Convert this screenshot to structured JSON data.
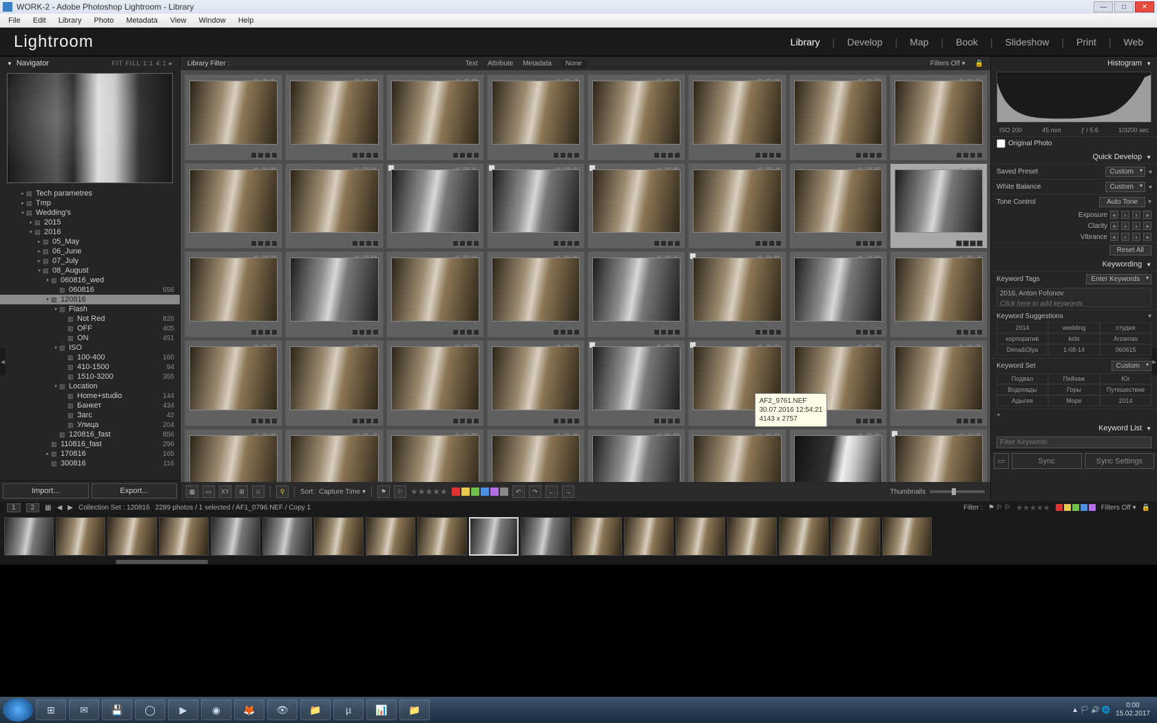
{
  "window_title": "WORK-2 - Adobe Photoshop Lightroom - Library",
  "menubar": [
    "File",
    "Edit",
    "Library",
    "Photo",
    "Metadata",
    "View",
    "Window",
    "Help"
  ],
  "logo": "Lightroom",
  "modules": [
    "Library",
    "Develop",
    "Map",
    "Book",
    "Slideshow",
    "Print",
    "Web"
  ],
  "active_module": "Library",
  "navigator": {
    "title": "Navigator",
    "opts": "FIT   FILL   1:1   4:1  ▸"
  },
  "tree": [
    {
      "indent": 2,
      "arr": "▸",
      "ic": "▤",
      "lbl": "Tech parametres",
      "cnt": ""
    },
    {
      "indent": 2,
      "arr": "▸",
      "ic": "▤",
      "lbl": "Tmp",
      "cnt": ""
    },
    {
      "indent": 2,
      "arr": "▾",
      "ic": "▤",
      "lbl": "Wedding's",
      "cnt": ""
    },
    {
      "indent": 3,
      "arr": "▸",
      "ic": "▤",
      "lbl": "2015",
      "cnt": ""
    },
    {
      "indent": 3,
      "arr": "▾",
      "ic": "▤",
      "lbl": "2016",
      "cnt": ""
    },
    {
      "indent": 4,
      "arr": "▸",
      "ic": "▤",
      "lbl": "05_May",
      "cnt": ""
    },
    {
      "indent": 4,
      "arr": "▸",
      "ic": "▤",
      "lbl": "06_June",
      "cnt": ""
    },
    {
      "indent": 4,
      "arr": "▸",
      "ic": "▤",
      "lbl": "07_July",
      "cnt": ""
    },
    {
      "indent": 4,
      "arr": "▾",
      "ic": "▤",
      "lbl": "08_August",
      "cnt": ""
    },
    {
      "indent": 5,
      "arr": "▾",
      "ic": "▥",
      "lbl": "060816_wed",
      "cnt": ""
    },
    {
      "indent": 6,
      "arr": "",
      "ic": "▥",
      "lbl": "060816",
      "cnt": "656"
    },
    {
      "indent": 5,
      "arr": "▾",
      "ic": "▥",
      "lbl": "120816",
      "cnt": "",
      "sel": true
    },
    {
      "indent": 6,
      "arr": "▾",
      "ic": "▥",
      "lbl": "Flash",
      "cnt": ""
    },
    {
      "indent": 7,
      "arr": "",
      "ic": "▥",
      "lbl": "Not Red",
      "cnt": "826"
    },
    {
      "indent": 7,
      "arr": "",
      "ic": "▥",
      "lbl": "OFF",
      "cnt": "405"
    },
    {
      "indent": 7,
      "arr": "",
      "ic": "▥",
      "lbl": "ON",
      "cnt": "451"
    },
    {
      "indent": 6,
      "arr": "▾",
      "ic": "▥",
      "lbl": "ISO",
      "cnt": ""
    },
    {
      "indent": 7,
      "arr": "",
      "ic": "▥",
      "lbl": "100-400",
      "cnt": "160"
    },
    {
      "indent": 7,
      "arr": "",
      "ic": "▥",
      "lbl": "410-1500",
      "cnt": "94"
    },
    {
      "indent": 7,
      "arr": "",
      "ic": "▥",
      "lbl": "1510-3200",
      "cnt": "355"
    },
    {
      "indent": 6,
      "arr": "▾",
      "ic": "▥",
      "lbl": "Location",
      "cnt": ""
    },
    {
      "indent": 7,
      "arr": "",
      "ic": "▥",
      "lbl": "Home+studio",
      "cnt": "144"
    },
    {
      "indent": 7,
      "arr": "",
      "ic": "▥",
      "lbl": "Банкет",
      "cnt": "434"
    },
    {
      "indent": 7,
      "arr": "",
      "ic": "▥",
      "lbl": "Загс",
      "cnt": "42"
    },
    {
      "indent": 7,
      "arr": "",
      "ic": "▥",
      "lbl": "Улица",
      "cnt": "204"
    },
    {
      "indent": 6,
      "arr": "",
      "ic": "▥",
      "lbl": "120816_fast",
      "cnt": "856"
    },
    {
      "indent": 5,
      "arr": "",
      "ic": "▥",
      "lbl": "110816_fast",
      "cnt": "296"
    },
    {
      "indent": 5,
      "arr": "▸",
      "ic": "▥",
      "lbl": "170816",
      "cnt": "165"
    },
    {
      "indent": 5,
      "arr": "",
      "ic": "▥",
      "lbl": "300816",
      "cnt": "116"
    }
  ],
  "left_buttons": {
    "import": "Import...",
    "export": "Export..."
  },
  "lib_filter": {
    "label": "Library Filter :",
    "items": [
      "Text",
      "Attribute",
      "Metadata",
      "None"
    ],
    "right": "Filters Off ▾",
    "lock": "🔒"
  },
  "grid": {
    "start": 161,
    "count": 48,
    "selected_index": 15,
    "bw": [
      10,
      11,
      15,
      17,
      20,
      22,
      28,
      36,
      46
    ],
    "dark": [
      38,
      45,
      47
    ],
    "flagged": [
      10,
      11,
      12,
      21,
      28,
      29,
      39
    ],
    "tooltip": {
      "idx": 29,
      "l1": "AF2_9761.NEF",
      "l2": "30.07.2016 12:54:21",
      "l3": "4143 x 2757"
    }
  },
  "ctool": {
    "sort_label": "Sort:",
    "sort_val": "Capture Time  ▾",
    "thumbnails": "Thumbnails",
    "colors": [
      "#d33",
      "#e6c84b",
      "#6fbf4b",
      "#4b8fe6",
      "#b46fe6",
      "#888"
    ]
  },
  "histogram": {
    "title": "Histogram",
    "iso": "ISO 200",
    "focal": "45 mm",
    "ap": "ƒ / 5.6",
    "sh": "1/3200 sec",
    "orig": "Original Photo"
  },
  "quickdev": {
    "title": "Quick Develop",
    "saved_preset": {
      "lbl": "Saved Preset",
      "val": "Custom"
    },
    "wb": {
      "lbl": "White Balance",
      "val": "Custom"
    },
    "tone": {
      "lbl": "Tone Control",
      "btn": "Auto Tone"
    },
    "exposure": "Exposure",
    "clarity": "Clarity",
    "vibrance": "Vibrance",
    "reset": "Reset All"
  },
  "keywording": {
    "title": "Keywording",
    "tags_label": "Keyword Tags",
    "tags_mode": "Enter Keywords",
    "applied": "2016, Anton Fofonov",
    "hint": "Click here to add keywords",
    "sugg_label": "Keyword Suggestions",
    "sugg": [
      "2014",
      "wedding",
      "студия",
      "корпоратив",
      "kids",
      "Arzamas",
      "Dima&Olya",
      "1-08-14",
      "060615"
    ],
    "set_label": "Keyword Set",
    "set_val": "Custom",
    "set": [
      "Подвал",
      "Пейзаж",
      "Юг",
      "Водопады",
      "Горы",
      "Путешествие",
      "Адыгея",
      "Море",
      "2014"
    ]
  },
  "keyword_list": {
    "title": "Keyword List",
    "filter": "Filter Keywords"
  },
  "sync": {
    "sync": "Sync",
    "settings": "Sync Settings"
  },
  "status": {
    "pages": [
      "1",
      "2"
    ],
    "collection": "Collection Set : 120816",
    "count": "2289 photos / 1 selected / AF1_0796.NEF / Copy 1",
    "filter_lbl": "Filter :",
    "filters_off": "Filters Off ▾"
  },
  "filmstrip": {
    "count": 18,
    "selected": 9,
    "bw": [
      0,
      4,
      5,
      9,
      10
    ]
  },
  "taskbar": {
    "icons": [
      "⊞",
      "✉",
      "💾",
      "◯",
      "▶",
      "◉",
      "🦊",
      "👁",
      "📁",
      "µ",
      "📊",
      "📁"
    ],
    "tray": [
      "▲",
      "🏳",
      "🔊",
      "🌐"
    ],
    "time": "0:00",
    "date": "15.02.2017"
  }
}
